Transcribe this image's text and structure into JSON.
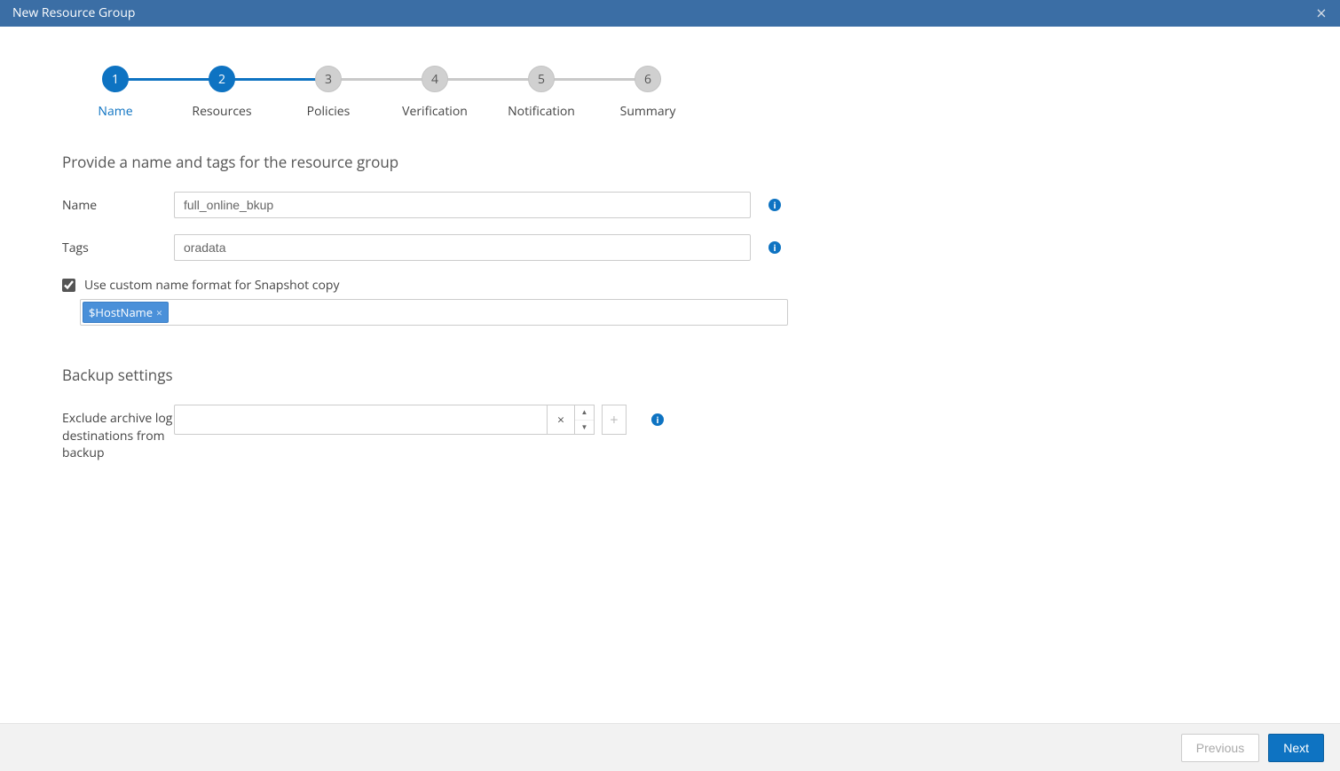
{
  "window": {
    "title": "New Resource Group"
  },
  "stepper": [
    {
      "num": "1",
      "label": "Name",
      "state": "active"
    },
    {
      "num": "2",
      "label": "Resources",
      "state": "done"
    },
    {
      "num": "3",
      "label": "Policies",
      "state": "todo"
    },
    {
      "num": "4",
      "label": "Verification",
      "state": "todo"
    },
    {
      "num": "5",
      "label": "Notification",
      "state": "todo"
    },
    {
      "num": "6",
      "label": "Summary",
      "state": "todo"
    }
  ],
  "form": {
    "section_title": "Provide a name and tags for the resource group",
    "name_label": "Name",
    "name_value": "full_online_bkup",
    "tags_label": "Tags",
    "tags_value": "oradata",
    "custom_name_label": "Use custom name format for Snapshot copy",
    "custom_name_checked": true,
    "custom_name_tokens": [
      "$HostName"
    ]
  },
  "backup": {
    "section_title": "Backup settings",
    "exclude_label": "Exclude archive log destinations from backup",
    "exclude_value": ""
  },
  "footer": {
    "previous": "Previous",
    "next": "Next"
  },
  "icons": {
    "info_glyph": "i",
    "close_glyph": "×",
    "up_glyph": "▲",
    "down_glyph": "▼",
    "plus_glyph": "+"
  }
}
